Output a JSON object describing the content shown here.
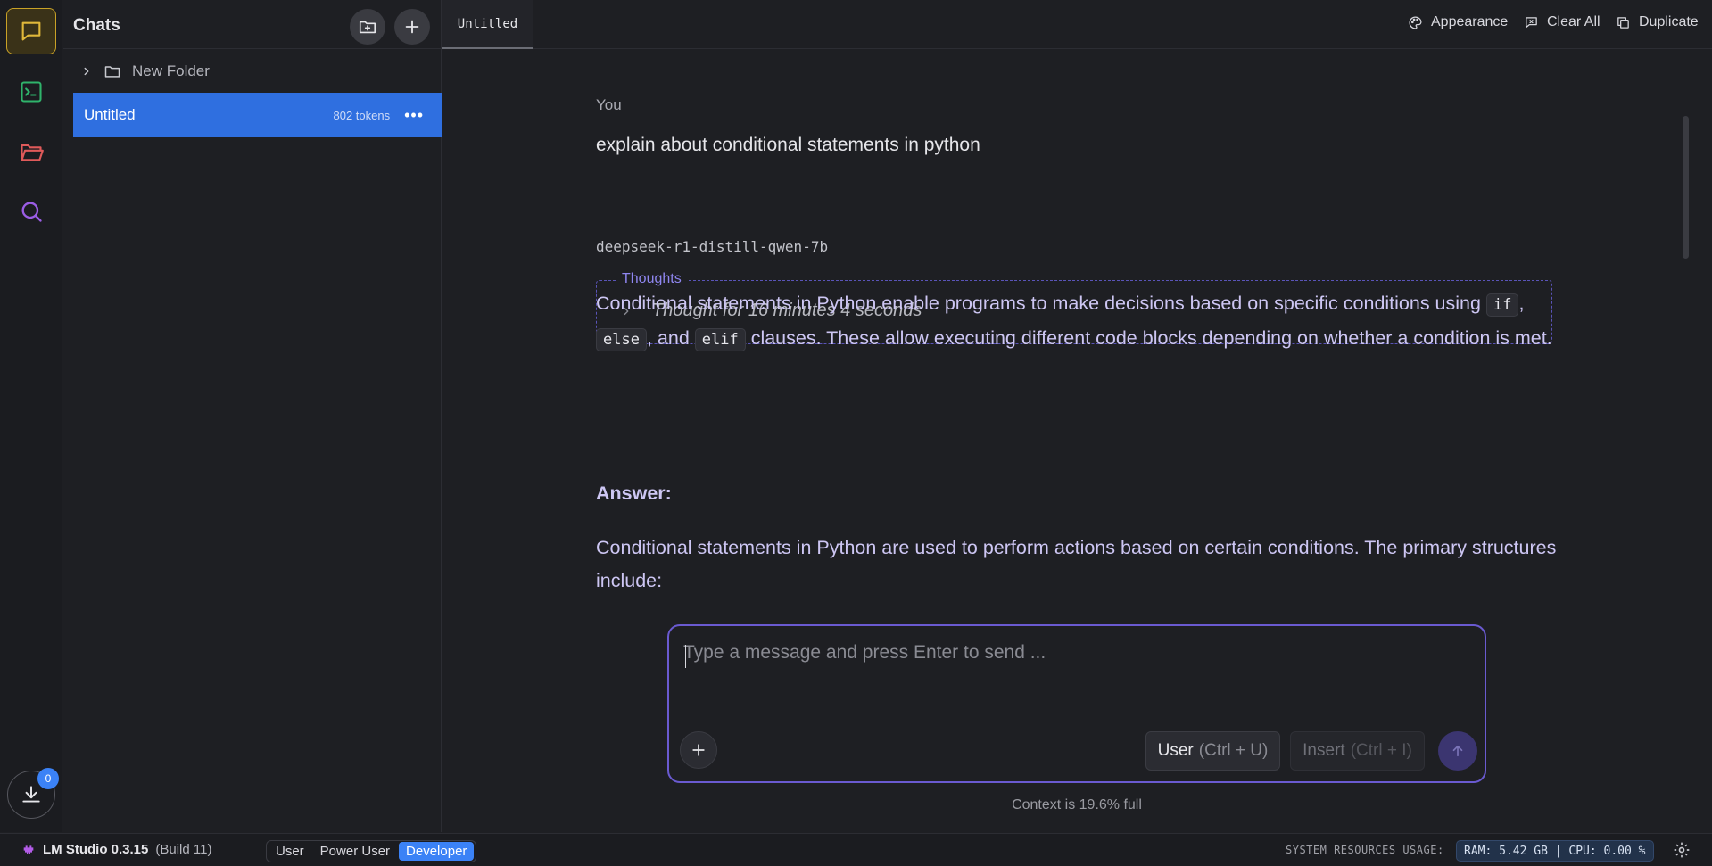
{
  "sidebar": {
    "title": "Chats",
    "folders": [
      {
        "name": "New Folder"
      }
    ],
    "chats": [
      {
        "title": "Untitled",
        "tokens": "802 tokens",
        "selected": true
      }
    ]
  },
  "tabs": [
    {
      "label": "Untitled",
      "active": true
    }
  ],
  "top_actions": {
    "appearance": "Appearance",
    "clear_all": "Clear All",
    "duplicate": "Duplicate"
  },
  "conversation": {
    "user": {
      "sender": "You",
      "text": "explain about conditional statements in python"
    },
    "assistant": {
      "model": "deepseek-r1-distill-qwen-7b",
      "thoughts_label": "Thoughts",
      "thought_summary": "Thought for 16 minutes 4 seconds",
      "paragraph1": {
        "part1": "Conditional statements in Python enable programs to make decisions based on specific conditions using",
        "code1": "if",
        "sep1": ",",
        "code2": "else",
        "sep2": ", and",
        "code3": "elif",
        "part2": "clauses. These allow executing different code blocks depending on whether a condition is met."
      },
      "answer_label": "Answer:",
      "paragraph2": "Conditional statements in Python are used to perform actions based on certain conditions. The primary structures include:"
    }
  },
  "composer": {
    "placeholder": "Type a message and press Enter to send ...",
    "value": "",
    "role_button": {
      "label": "User",
      "shortcut": "(Ctrl + U)"
    },
    "insert_button": {
      "label": "Insert",
      "shortcut": "(Ctrl + I)"
    },
    "context_text": "Context is 19.6% full"
  },
  "rail": {
    "download_badge": "0"
  },
  "statusbar": {
    "app_name": "LM Studio 0.3.15",
    "build": "(Build 11)",
    "modes": [
      "User",
      "Power User",
      "Developer"
    ],
    "active_mode": "Developer",
    "resources_label": "SYSTEM RESOURCES USAGE:",
    "resources_value": "RAM: 5.42 GB | CPU: 0.00 %"
  },
  "colors": {
    "accent_yellow": "#c9a227",
    "accent_blue": "#3b82f6",
    "selected_chat": "#2f6fe0",
    "composer_border": "#6a5ad0",
    "answer_text": "#cdc6f3",
    "thoughts_border": "#5a54b8"
  },
  "icons": [
    "chat-icon",
    "terminal-icon",
    "folder-icon",
    "search-icon",
    "download-icon",
    "new-folder-icon",
    "plus-icon",
    "chevron-right-icon",
    "palette-icon",
    "clear-icon",
    "duplicate-icon",
    "send-icon",
    "gear-icon",
    "lmstudio-logo-icon"
  ]
}
